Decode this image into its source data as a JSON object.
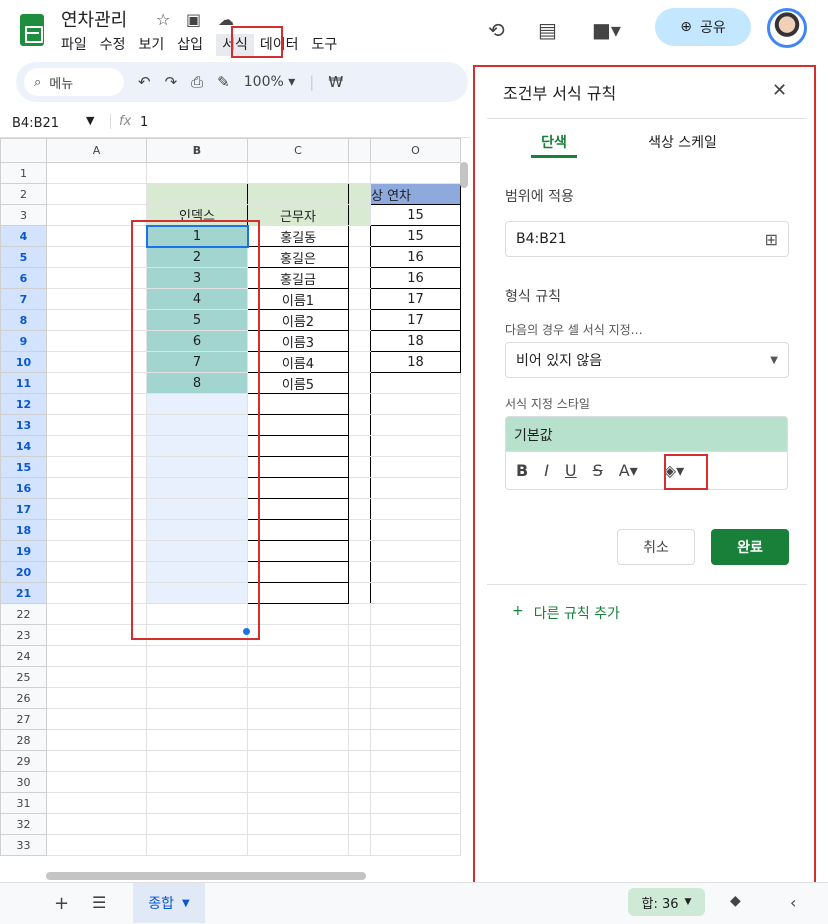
{
  "app": {
    "title": "연차관리",
    "menu": [
      "파일",
      "수정",
      "보기",
      "삽입",
      "서식",
      "데이터",
      "도구"
    ],
    "share": "공유"
  },
  "toolbar": {
    "search": "메뉴",
    "zoom": "100%",
    "currency": "₩"
  },
  "formula": {
    "namebox": "B4:B21",
    "fx": "fx",
    "value": "1"
  },
  "columns": [
    "A",
    "B",
    "C",
    "O"
  ],
  "rows": [
    "1",
    "2",
    "3",
    "4",
    "5",
    "6",
    "7",
    "8",
    "9",
    "10",
    "11",
    "12",
    "13",
    "14",
    "15",
    "16",
    "17",
    "18",
    "19",
    "20",
    "21",
    "22",
    "23",
    "24",
    "25",
    "26",
    "27",
    "28",
    "29",
    "30",
    "31",
    "32",
    "33"
  ],
  "sheet": {
    "header_b": "인덱스",
    "header_c": "근무자",
    "header_o": "상 연차",
    "index": [
      "1",
      "2",
      "3",
      "4",
      "5",
      "6",
      "7",
      "8"
    ],
    "names": [
      "홍길동",
      "홍길은",
      "홍길금",
      "이름1",
      "이름2",
      "이름3",
      "이름4",
      "이름5"
    ],
    "o_values": [
      "15",
      "15",
      "16",
      "16",
      "17",
      "17",
      "18",
      "18"
    ]
  },
  "panel": {
    "title": "조건부 서식 규칙",
    "tab_single": "단색",
    "tab_scale": "색상 스케일",
    "apply_label": "범위에 적용",
    "range": "B4:B21",
    "rules_label": "형식 규칙",
    "condition_label": "다음의 경우 셀 서식 지정…",
    "condition": "비어 있지 않음",
    "style_label": "서식 지정 스타일",
    "style_preview": "기본값",
    "cancel": "취소",
    "done": "완료",
    "add_rule": "다른 규칙 추가"
  },
  "bottom": {
    "sheet_tab": "종합",
    "sum": "합: 36"
  },
  "colors": {
    "accent": "#188038",
    "selection": "#e8f0fe",
    "teal": "#a2d5cf",
    "highlight_red": "#d32f2f"
  }
}
